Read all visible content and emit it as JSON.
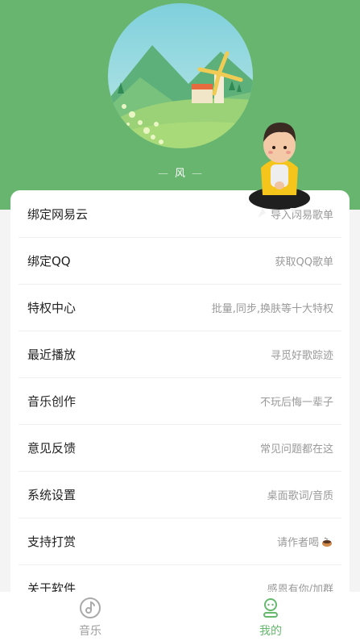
{
  "profile": {
    "nickname": "风"
  },
  "menu": [
    {
      "label": "绑定网易云",
      "hint": "导入网易歌单"
    },
    {
      "label": "绑定QQ",
      "hint": "获取QQ歌单"
    },
    {
      "label": "特权中心",
      "hint": "批量,同步,换肤等十大特权"
    },
    {
      "label": "最近播放",
      "hint": "寻觅好歌踪迹"
    },
    {
      "label": "音乐创作",
      "hint": "不玩后悔一辈子"
    },
    {
      "label": "意见反馈",
      "hint": "常见问题都在这"
    },
    {
      "label": "系统设置",
      "hint": "桌面歌词/音质"
    },
    {
      "label": "支持打赏",
      "hint": "请作者喝"
    },
    {
      "label": "关于软件",
      "hint": "感恩有你/加群"
    }
  ],
  "tabbar": {
    "music": "音乐",
    "mine": "我的"
  },
  "colors": {
    "header": "#68b56f",
    "active_tab": "#64b96c",
    "inactive_tab": "#9e9e9e"
  }
}
